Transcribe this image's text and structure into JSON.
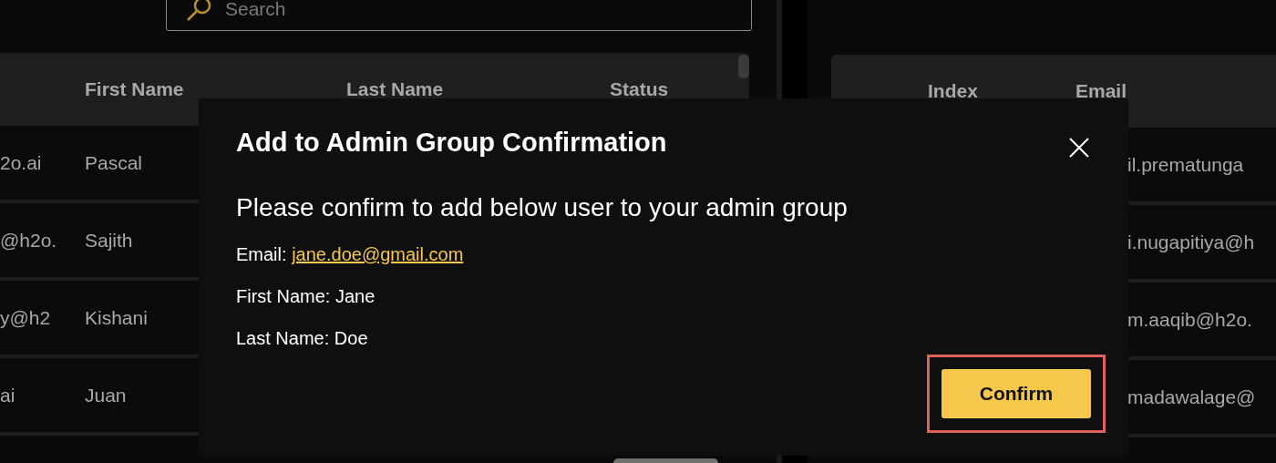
{
  "search": {
    "placeholder": "Search"
  },
  "left_table": {
    "columns": [
      "First Name",
      "Last Name",
      "Status"
    ],
    "rows": [
      {
        "email": "2o.ai",
        "first_name": "Pascal"
      },
      {
        "email": "@h2o.",
        "first_name": "Sajith"
      },
      {
        "email": "y@h2",
        "first_name": "Kishani"
      },
      {
        "email": "ai",
        "first_name": "Juan"
      }
    ]
  },
  "right_table": {
    "columns": [
      "Index",
      "Email"
    ],
    "rows": [
      {
        "email": "il.prematunga"
      },
      {
        "email": "i.nugapitiya@h"
      },
      {
        "email": "m.aaqib@h2o."
      },
      {
        "email": "madawalage@"
      }
    ]
  },
  "dialog": {
    "title": "Add to Admin Group Confirmation",
    "message": "Please confirm to add below user to your admin group",
    "email_label": "Email:",
    "email": "jane.doe@gmail.com",
    "details": [
      "First Name: Jane",
      "Last Name: Doe"
    ],
    "confirm": {
      "label": "Confirm",
      "highlighted": true
    }
  }
}
